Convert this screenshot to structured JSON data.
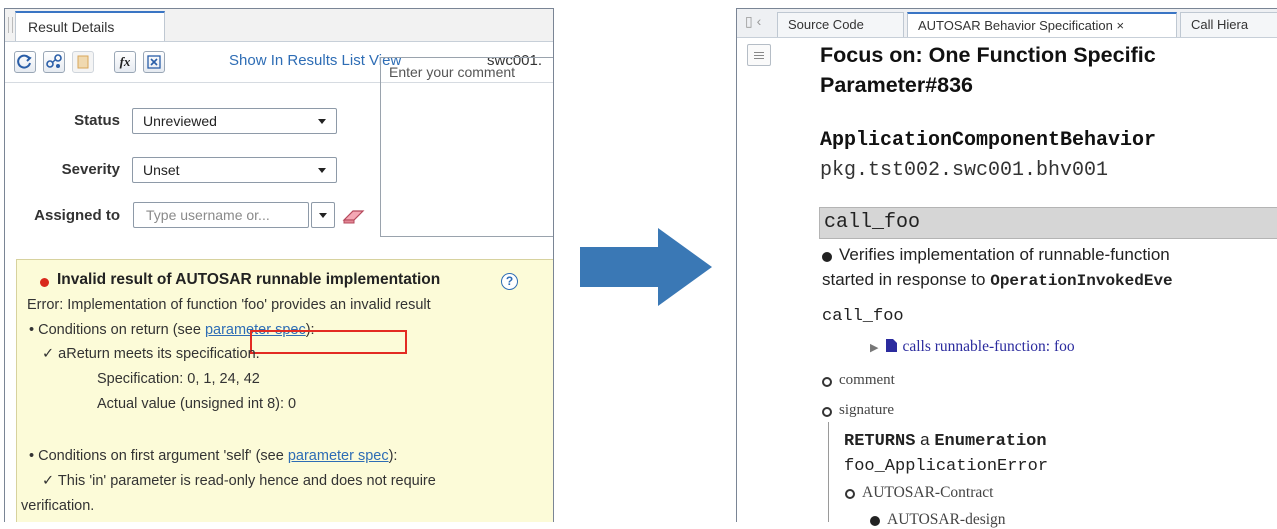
{
  "left": {
    "tab_label": "Result Details",
    "toolbar": {
      "show_in_results": "Show In Results List View",
      "swc_label": "swc001.",
      "icons": [
        "refresh-icon",
        "graph-icon",
        "bookmark-icon",
        "function-icon",
        "cross-ref-icon"
      ],
      "fx_glyph": "fx"
    },
    "form": {
      "status_label": "Status",
      "status_value": "Unreviewed",
      "severity_label": "Severity",
      "severity_value": "Unset",
      "assigned_label": "Assigned to",
      "assigned_placeholder": "Type username or...",
      "comment_placeholder": "Enter your comment"
    },
    "result": {
      "title": "Invalid result of AUTOSAR runnable implementation",
      "help_glyph": "?",
      "error_line": "Error: Implementation of function 'foo' provides an invalid result",
      "cond_return_prefix": "• Conditions on return (see ",
      "link_text": "parameter spec",
      "cond_return_suffix": "):",
      "areturn_line": "✓ aReturn meets its specification.",
      "spec_line": "Specification: 0, 1, 24, 42",
      "actual_line": "Actual value (unsigned int 8): 0",
      "cond_first_prefix": "• Conditions on first argument 'self' (see ",
      "link_text_2": "parameter spec",
      "cond_first_suffix": "):",
      "self_line": "✓ This 'in' parameter is read-only hence and does not require",
      "verification_line": "verification."
    }
  },
  "right": {
    "tabs": [
      "Source Code",
      "AUTOSAR Behavior Specification ×",
      "Call Hiera"
    ],
    "heading_line1": "Focus on: One Function Specific",
    "heading_line2": "Parameter#836",
    "component_label": "ApplicationComponentBehavior",
    "component_path": "pkg.tst002.swc001.bhv001",
    "call_name": "call_foo",
    "verifies_line1": "Verifies implementation of runnable-function",
    "verifies_line2_prefix": "started in response to ",
    "verifies_line2_code": "OperationInvokedEve",
    "call_name_2": "call_foo",
    "calls_line": "calls runnable-function: foo",
    "comment_label": "comment",
    "signature_label": "signature",
    "returns_kw": "RETURNS",
    "returns_a": "a",
    "returns_type": "Enumeration",
    "error_type": "foo_ApplicationError",
    "contract_label": "AUTOSAR-Contract",
    "design_label": "AUTOSAR-design"
  },
  "colors": {
    "accent": "#2e6db5",
    "arrow": "#3a78b5",
    "highlight": "#e32b22",
    "result_bg": "#fcfbd8"
  }
}
